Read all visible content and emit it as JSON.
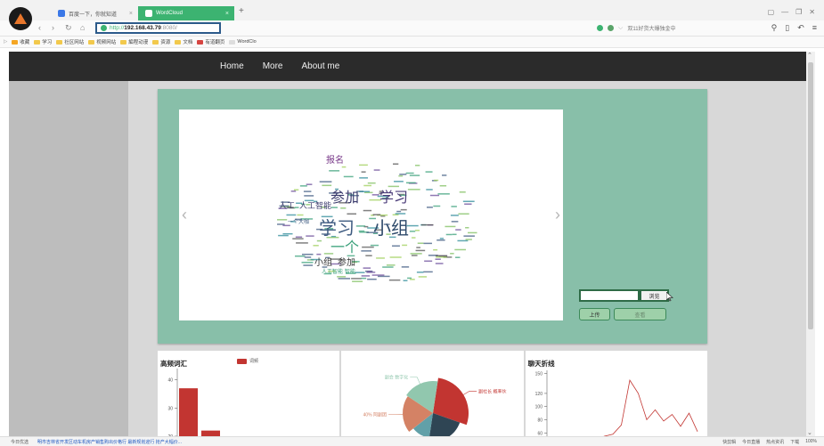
{
  "browser": {
    "tabs": [
      {
        "title": "百度一下，你就知道",
        "active": false
      },
      {
        "title": "WordCloud",
        "active": true
      }
    ],
    "address": {
      "scheme": "http://",
      "host": "192.168.43.79",
      "port": ":8080/"
    },
    "search_hint": "双11好货大爆独金中",
    "bookmarks": [
      "收藏",
      "学习",
      "社区网站",
      "视频网站",
      "編程动漫",
      "资源",
      "文档",
      "有道翻页",
      "WordClo"
    ],
    "status_news": "明市吉林省开发区动车机房产销售购出价格行 最新规划迎行 抢产大幅价...",
    "status_left": "今日优选",
    "status_right": [
      "快剪辑",
      "今日直播",
      "热点资讯",
      "下载",
      "100%"
    ]
  },
  "site": {
    "nav": [
      "Home",
      "More",
      "About me"
    ],
    "browse_label": "浏览",
    "upload_label": "上传",
    "query_label": "查看",
    "wordcloud": {
      "words": [
        {
          "text": "学习",
          "size": 20,
          "color": "#3d5a80",
          "x": 0,
          "y": 0
        },
        {
          "text": "小组",
          "size": 20,
          "color": "#2e4a6b",
          "x": 0,
          "y": 0
        },
        {
          "text": "参加",
          "size": 16,
          "color": "#3b3b6d",
          "x": 0,
          "y": 0
        },
        {
          "text": "学习",
          "size": 16,
          "color": "#4a3b78",
          "x": 0,
          "y": 0
        },
        {
          "text": "一个",
          "size": 16,
          "color": "#3aa07a",
          "x": 0,
          "y": 0
        },
        {
          "text": "小组",
          "size": 10,
          "color": "#333333",
          "x": 0,
          "y": 0
        },
        {
          "text": "参加",
          "size": 10,
          "color": "#333333",
          "x": 0,
          "y": 0
        },
        {
          "text": "人工",
          "size": 9,
          "color": "#3b3b6d",
          "x": 0,
          "y": 0
        },
        {
          "text": "人工智能",
          "size": 9,
          "color": "#3b3b6d",
          "x": 0,
          "y": 0
        },
        {
          "text": "报名",
          "size": 10,
          "color": "#7a3b8a",
          "x": 0,
          "y": 0
        },
        {
          "text": "人工智能 智能",
          "size": 6,
          "color": "#3aa07a",
          "x": 0,
          "y": 0
        },
        {
          "text": "一个大咖",
          "size": 6,
          "color": "#3d5a80",
          "x": 0,
          "y": 0
        }
      ]
    }
  },
  "panels": {
    "freq": {
      "title": "高频词汇",
      "legend": "词频",
      "bar_color": "#c23531",
      "chart_data": {
        "type": "bar",
        "yticks": [
          20,
          30,
          40
        ],
        "values": [
          37,
          22,
          20
        ],
        "ylim": [
          20,
          44
        ]
      }
    },
    "pie": {
      "chart_data": {
        "type": "pie",
        "slices": [
          {
            "label": "副社长 概率伙",
            "value": 28,
            "color": "#c23531"
          },
          {
            "label": "",
            "value": 22,
            "color": "#2f4554"
          },
          {
            "label": "",
            "value": 12,
            "color": "#61a0a8"
          },
          {
            "label": "40% 阿副团",
            "value": 20,
            "color": "#d48265"
          },
          {
            "label": "副会 数字化",
            "value": 18,
            "color": "#91c7ae"
          }
        ]
      }
    },
    "line": {
      "title": "聊天折线",
      "line_color": "#c23531",
      "chart_data": {
        "type": "line",
        "yticks": [
          60,
          80,
          100,
          120,
          150
        ],
        "values": [
          50,
          55,
          58,
          72,
          140,
          120,
          80,
          95,
          78,
          88,
          70,
          90,
          62
        ],
        "ylim": [
          55,
          155
        ]
      }
    }
  }
}
